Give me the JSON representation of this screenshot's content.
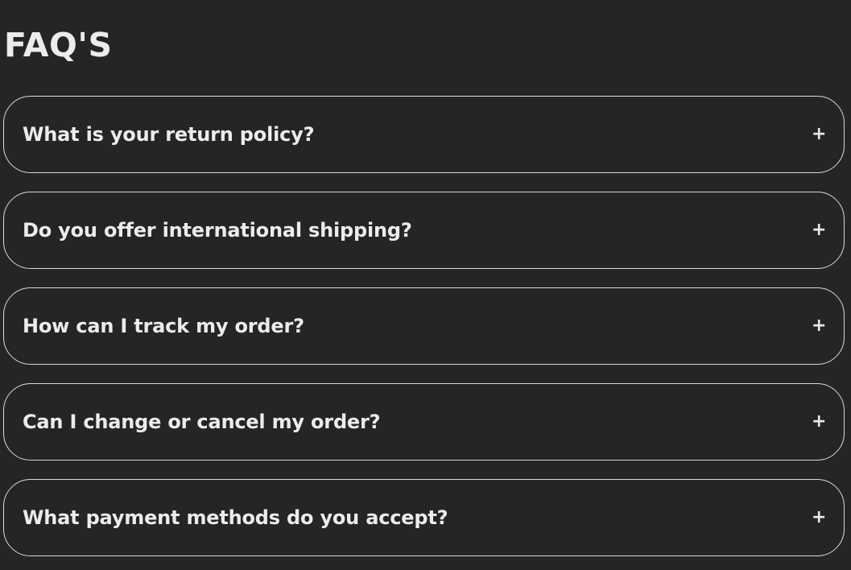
{
  "page": {
    "title": "FAQ'S",
    "background_color": "#252525",
    "text_color": "#ececec",
    "border_color": "#d9d9d9"
  },
  "faqs": [
    {
      "question": "What is your return policy?",
      "icon": "+",
      "icon_name": "plus-icon"
    },
    {
      "question": "Do you offer international shipping?",
      "icon": "+",
      "icon_name": "plus-icon"
    },
    {
      "question": "How can I track my order?",
      "icon": "+",
      "icon_name": "plus-icon"
    },
    {
      "question": "Can I change or cancel my order?",
      "icon": "+",
      "icon_name": "plus-icon"
    },
    {
      "question": "What payment methods do you accept?",
      "icon": "+",
      "icon_name": "plus-icon"
    }
  ]
}
